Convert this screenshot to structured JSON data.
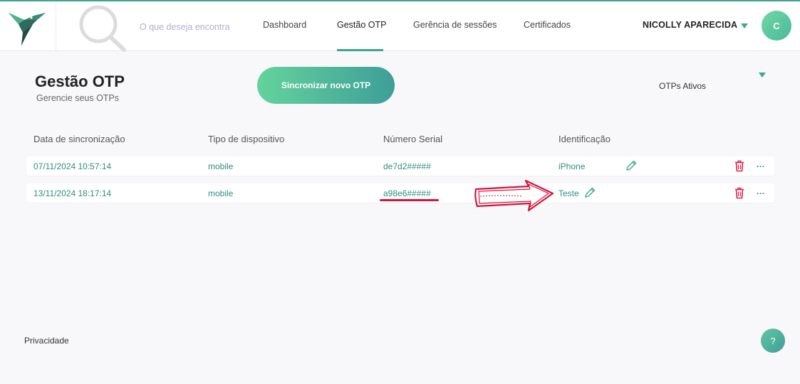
{
  "colors": {
    "accent": "#3fa58e",
    "delete": "#e0244a",
    "annotation": "#d7143a"
  },
  "search": {
    "placeholder": "O que deseja encontra"
  },
  "nav": {
    "items": [
      {
        "label": "Dashboard"
      },
      {
        "label": "Gestão OTP"
      },
      {
        "label": "Gerência de sessões"
      },
      {
        "label": "Certificados"
      }
    ],
    "active": "Gestão OTP"
  },
  "user": {
    "name": "NICOLLY APARECIDA",
    "avatar_initial": "C"
  },
  "page": {
    "title": "Gestão OTP",
    "subtitle": "Gerencie seus OTPs"
  },
  "actions": {
    "sync_label": "Sincronizar novo OTP"
  },
  "filter": {
    "selected": "OTPs Ativos"
  },
  "table": {
    "headers": [
      "Data de sincronização",
      "Tipo de dispositivo",
      "Número Serial",
      "Identificação"
    ],
    "rows": [
      {
        "date": "07/11/2024 10:57:14",
        "type": "mobile",
        "serial": "de7d2#####",
        "identification": "iPhone"
      },
      {
        "date": "13/11/2024 18:17:14",
        "type": "mobile",
        "serial": "a98e6#####",
        "identification": "Teste"
      }
    ],
    "more_label": "..."
  },
  "footer": {
    "privacy": "Privacidade",
    "help": "?"
  },
  "icons": {
    "logo": "hummingbird-logo",
    "search": "search-icon",
    "caret": "chevron-down-icon",
    "edit": "pencil-icon",
    "delete": "trash-icon",
    "more": "ellipsis-icon"
  }
}
